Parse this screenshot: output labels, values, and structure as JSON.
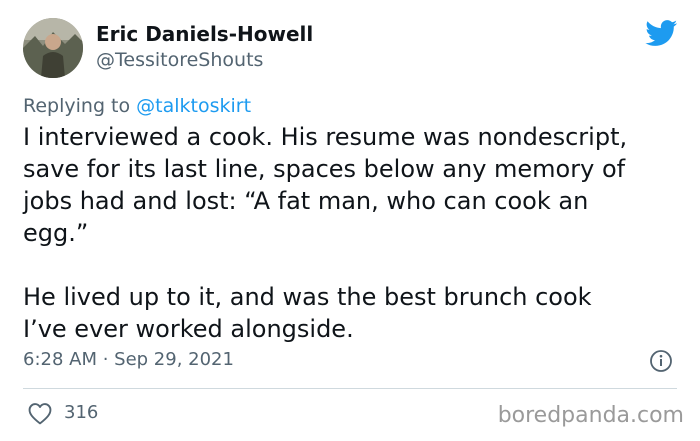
{
  "author": {
    "display_name": "Eric Daniels-Howell",
    "handle": "@TessitoreShouts"
  },
  "reply": {
    "prefix": "Replying to",
    "mention": "@talktoskirt"
  },
  "tweet": {
    "lines": [
      "I interviewed a cook. His resume was nondescript,",
      "save for its last line, spaces below any memory of",
      "jobs had and lost: “A fat man, who can cook an",
      "egg.”",
      "He lived up to it, and was the best brunch cook",
      "I’ve ever worked alongside."
    ]
  },
  "meta": {
    "timestamp": "6:28 AM · Sep 29, 2021"
  },
  "engagement": {
    "likes": "316"
  },
  "watermark": "boredpanda.com",
  "icons": {
    "brand": "twitter-bird-icon",
    "info": "info-icon",
    "like": "heart-icon"
  },
  "colors": {
    "twitter_blue": "#1d9bf0",
    "secondary_text": "#536471",
    "primary_text": "#0f1419",
    "divider": "#cfd9de"
  }
}
